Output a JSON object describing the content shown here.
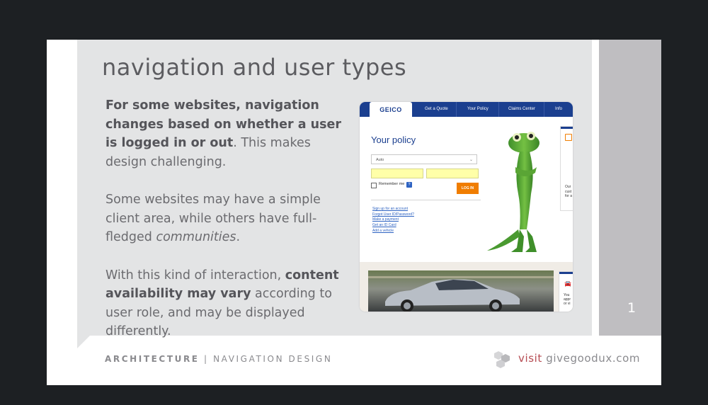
{
  "slide": {
    "title": "navigation and user types",
    "paragraphs": {
      "p1": {
        "bold": "For some websites, navigation changes based on whether a user is logged in or out",
        "rest": ". This makes design challenging."
      },
      "p2": {
        "text": "Some websites may have a simple client area, while others have full-fledged ",
        "italic": "communities",
        "end": "."
      },
      "p3": {
        "start": "With this kind of interaction, ",
        "bold": "content availability may vary",
        "rest": " according to user role, and may be displayed differently."
      }
    },
    "page_number": "1",
    "footer": {
      "section_bold": "ARCHITECTURE",
      "separator": "|",
      "section_rest": "NAVIGATION DESIGN",
      "visit_label": "visit",
      "site": "givegoodux.com"
    },
    "colors": {
      "panel": "#e3e4e5",
      "side_strip": "#bfbec1",
      "visit_accent": "#b64b52",
      "geico_blue": "#1b3f8f",
      "geico_orange": "#f07d00"
    }
  },
  "screenshot": {
    "nav": {
      "logo": "GEICO",
      "items": [
        "Get a Quote",
        "Your Policy",
        "Claims Center",
        "Info Center"
      ]
    },
    "policy_title": "Your policy",
    "select_value": "Auto",
    "remember_label": "Remember me",
    "help_badge": "?",
    "login_label": "LOG IN",
    "links": [
      "Sign up for an account",
      "Forgot User ID/Password?",
      "Make a payment",
      "Get an ID Card",
      "Add a vehicle"
    ],
    "right_card_text": [
      "Our",
      "cust",
      "for a"
    ],
    "bottom_card_text": [
      "You",
      "appr",
      "or vi"
    ],
    "icons": {
      "chevron": "chevron-down-icon",
      "car": "car-icon",
      "calendar": "calendar-icon"
    }
  }
}
